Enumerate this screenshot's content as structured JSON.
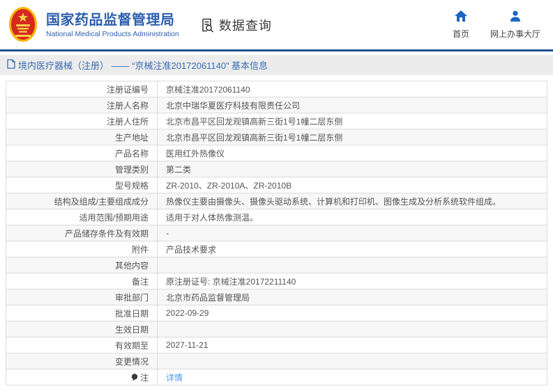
{
  "header": {
    "title": "国家药品监督管理局",
    "subtitle": "National Medical Products Administration",
    "section": "数据查询",
    "nav": [
      {
        "label": "首页",
        "icon": "home-icon"
      },
      {
        "label": "网上办事大厅",
        "icon": "person-icon"
      }
    ]
  },
  "breadcrumb": "境内医疗器械（注册） —— “京械注准20172061140” 基本信息",
  "table": {
    "rows": [
      {
        "label": "注册证编号",
        "value": "京械注准20172061140"
      },
      {
        "label": "注册人名称",
        "value": "北京中瑞华夏医疗科技有限责任公司"
      },
      {
        "label": "注册人住所",
        "value": "北京市昌平区回龙观镇高新三街1号1幢二层东侧"
      },
      {
        "label": "生产地址",
        "value": "北京市昌平区回龙观镇高新三街1号1幢二层东侧"
      },
      {
        "label": "产品名称",
        "value": "医用红外热像仪"
      },
      {
        "label": "管理类别",
        "value": "第二类"
      },
      {
        "label": "型号规格",
        "value": "ZR-2010、ZR-2010A、ZR-2010B"
      },
      {
        "label": "结构及组成/主要组成成分",
        "value": "热像仪主要由摄像头、摄像头驱动系统、计算机和打印机、图像生成及分析系统软件组成。"
      },
      {
        "label": "适用范围/预期用途",
        "value": "适用于对人体热像测温。"
      },
      {
        "label": "产品储存条件及有效期",
        "value": "-"
      },
      {
        "label": "附件",
        "value": "产品技术要求"
      },
      {
        "label": "其他内容",
        "value": ""
      },
      {
        "label": "备注",
        "value": "原注册证号: 京械注准20172211140"
      },
      {
        "label": "审批部门",
        "value": "北京市药品监督管理局"
      },
      {
        "label": "批准日期",
        "value": "2022-09-29"
      },
      {
        "label": "生效日期",
        "value": ""
      },
      {
        "label": "有效期至",
        "value": "2027-11-21"
      },
      {
        "label": "变更情况",
        "value": ""
      },
      {
        "label": "注",
        "value": "详情",
        "label_icon": "note-icon",
        "value_is_link": true
      }
    ]
  },
  "colors": {
    "brand_blue": "#2d5fae",
    "nav_icon_blue": "#1b64c2",
    "header_rule": "#1d4f91",
    "breadcrumb_bg": "#ececec",
    "breadcrumb_text": "#3a6cb5",
    "table_border": "#dcdcdc",
    "row_stripe": "#f7f7f7",
    "text_gray": "#555555",
    "link_blue": "#4e97e8",
    "emblem_red": "#d6281e",
    "emblem_gold": "#f4c430"
  }
}
